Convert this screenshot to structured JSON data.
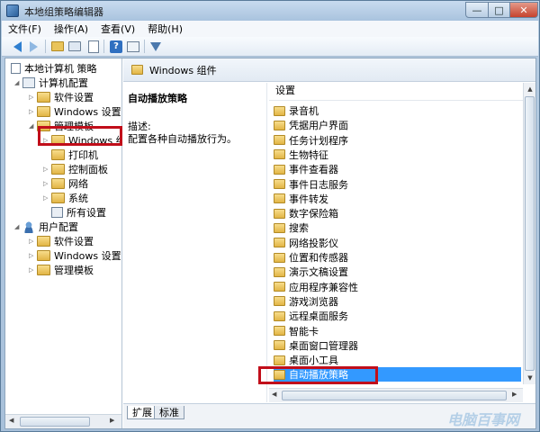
{
  "window": {
    "title": "本地组策略编辑器"
  },
  "window_controls": {
    "minimize": "—",
    "maximize": "□",
    "close": "✕"
  },
  "menu": [
    "文件(F)",
    "操作(A)",
    "查看(V)",
    "帮助(H)"
  ],
  "toolbar": {
    "icons": [
      "back-arrow-icon",
      "forward-arrow-icon",
      "up-folder-icon",
      "show-tree-icon",
      "doc-icon",
      "help-icon",
      "properties-icon",
      "filter-icon"
    ],
    "help_glyph": "?"
  },
  "tree": {
    "root": "本地计算机 策略",
    "computer_config": "计算机配置",
    "computer_children": [
      "软件设置",
      "Windows 设置",
      "管理模板"
    ],
    "admin_template_children": [
      "Windows 组",
      "打印机",
      "控制面板",
      "网络",
      "系统",
      "所有设置"
    ],
    "user_config": "用户配置",
    "user_children": [
      "软件设置",
      "Windows 设置",
      "管理模板"
    ]
  },
  "path_bar": {
    "title": "Windows 组件"
  },
  "description": {
    "title": "自动播放策略",
    "label": "描述:",
    "text": "配置各种自动播放行为。"
  },
  "list": {
    "header": "设置",
    "items": [
      "录音机",
      "凭据用户界面",
      "任务计划程序",
      "生物特征",
      "事件查看器",
      "事件日志服务",
      "事件转发",
      "数字保险箱",
      "搜索",
      "网络投影仪",
      "位置和传感器",
      "演示文稿设置",
      "应用程序兼容性",
      "游戏浏览器",
      "远程桌面服务",
      "智能卡",
      "桌面窗口管理器",
      "桌面小工具",
      "自动播放策略"
    ],
    "selected": "自动播放策略"
  },
  "tabs": [
    "扩展",
    "标准"
  ],
  "watermark": "电脑百事网",
  "colors": {
    "highlight_box": "#c10e1a",
    "selection": "#3399ff"
  }
}
